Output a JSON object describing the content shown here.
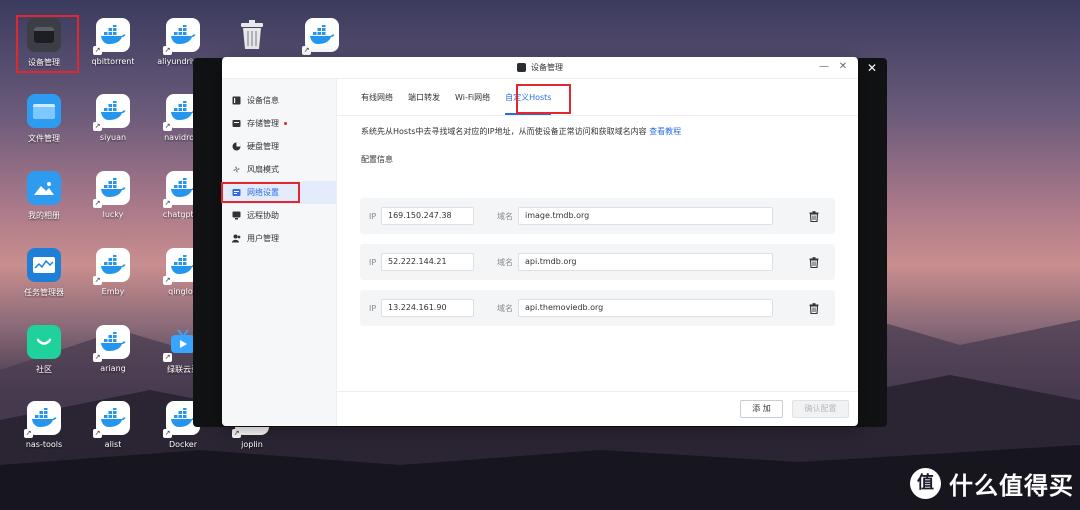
{
  "desktop": {
    "icons": [
      {
        "label": "设备管理",
        "kind": "device"
      },
      {
        "label": "qbittorrent",
        "kind": "docker"
      },
      {
        "label": "aliyundrive-s",
        "kind": "docker"
      },
      {
        "label": "文件管理",
        "kind": "folder"
      },
      {
        "label": "siyuan",
        "kind": "docker"
      },
      {
        "label": "navidrom",
        "kind": "docker"
      },
      {
        "label": "我的相册",
        "kind": "photos"
      },
      {
        "label": "lucky",
        "kind": "docker"
      },
      {
        "label": "chatgpt-w",
        "kind": "docker"
      },
      {
        "label": "任务管理器",
        "kind": "taskmgr"
      },
      {
        "label": "Emby",
        "kind": "docker"
      },
      {
        "label": "qinglon",
        "kind": "docker"
      },
      {
        "label": "社区",
        "kind": "community"
      },
      {
        "label": "ariang",
        "kind": "docker"
      },
      {
        "label": "绿联云录",
        "kind": "tv"
      },
      {
        "label": "nas-tools",
        "kind": "docker"
      },
      {
        "label": "alist",
        "kind": "docker"
      },
      {
        "label": "Docker",
        "kind": "docker"
      },
      {
        "label": "joplin",
        "kind": "docker"
      }
    ]
  },
  "dialog": {
    "title": "设备管理",
    "minimize": "—",
    "close": "✕",
    "sidebar": [
      {
        "label": "设备信息",
        "icon": "info-icon"
      },
      {
        "label": "存储管理",
        "icon": "storage-icon",
        "badge": true
      },
      {
        "label": "硬盘管理",
        "icon": "disk-icon"
      },
      {
        "label": "风扇模式",
        "icon": "fan-icon"
      },
      {
        "label": "网络设置",
        "icon": "network-icon",
        "active": true
      },
      {
        "label": "远程协助",
        "icon": "remote-icon"
      },
      {
        "label": "用户管理",
        "icon": "users-icon"
      }
    ],
    "tabs": [
      "有线网络",
      "端口转发",
      "Wi-Fi网络",
      "自定义Hosts"
    ],
    "active_tab": "自定义Hosts",
    "description": "系统先从Hosts中去寻找域名对应的IP地址，从而使设备正常访问和获取域名内容",
    "tutorial_link": "查看教程",
    "section_title": "配置信息",
    "ip_label": "IP",
    "domain_label": "域名",
    "hosts": [
      {
        "ip": "169.150.247.38",
        "domain": "image.tmdb.org"
      },
      {
        "ip": "52.222.144.21",
        "domain": "api.tmdb.org"
      },
      {
        "ip": "13.224.161.90",
        "domain": "api.themoviedb.org"
      }
    ],
    "add_button": "添 加",
    "confirm_button": "确认配置"
  },
  "dark_close": "✕",
  "watermark": {
    "mark": "值",
    "text": "什么值得买"
  },
  "colors": {
    "accent": "#2b6de5",
    "highlight": "#e0282e"
  }
}
